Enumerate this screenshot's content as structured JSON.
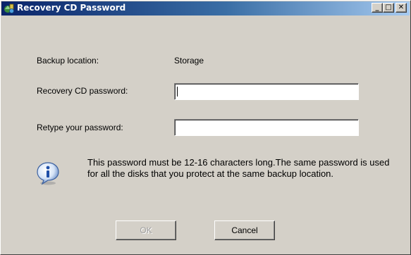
{
  "window": {
    "title": "Recovery CD Password",
    "minimize_glyph": "_",
    "maximize_glyph": "□",
    "close_glyph": "✕",
    "title_icon": "recovery-app-icon"
  },
  "form": {
    "backup_location_label": "Backup location:",
    "backup_location_value": "Storage",
    "password_label": "Recovery CD password:",
    "password_value": "",
    "retype_label": "Retype your password:",
    "retype_value": ""
  },
  "info": {
    "icon": "info-icon",
    "message": "This password must be 12-16 characters long.The same password is used for all the disks that you protect at the same backup location."
  },
  "buttons": {
    "ok_label": "OK",
    "ok_enabled": false,
    "cancel_label": "Cancel"
  },
  "colors": {
    "titlebar_start": "#0a246a",
    "titlebar_end": "#a6caf0",
    "dialog_background": "#d4d0c8"
  }
}
